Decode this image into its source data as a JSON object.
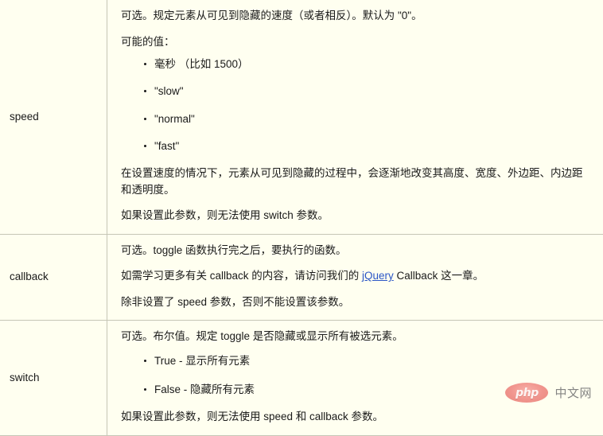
{
  "page": {
    "background_color": "#fffff0",
    "border_color": "#c6c6b6",
    "text_color": "#1a1a1a",
    "link_color": "#2b56c6"
  },
  "table": {
    "rows": [
      {
        "name": "speed",
        "blocks": [
          {
            "type": "paragraph",
            "text": "可选。规定元素从可见到隐藏的速度（或者相反）。默认为 \"0\"。"
          },
          {
            "type": "paragraph",
            "text": "可能的值："
          },
          {
            "type": "list",
            "items": [
              "毫秒 （比如 1500）",
              "\"slow\"",
              "\"normal\"",
              "\"fast\""
            ]
          },
          {
            "type": "paragraph",
            "text": "在设置速度的情况下，元素从可见到隐藏的过程中，会逐渐地改变其高度、宽度、外边距、内边距和透明度。"
          },
          {
            "type": "paragraph",
            "text": "如果设置此参数，则无法使用 switch 参数。"
          }
        ]
      },
      {
        "name": "callback",
        "blocks": [
          {
            "type": "paragraph",
            "text": "可选。toggle 函数执行完之后，要执行的函数。"
          },
          {
            "type": "paragraph_with_link",
            "before": "如需学习更多有关 callback 的内容，请访问我们的 ",
            "link_text": "jQuery",
            "after": " Callback 这一章。"
          },
          {
            "type": "paragraph",
            "text": "除非设置了 speed 参数，否则不能设置该参数。"
          }
        ]
      },
      {
        "name": "switch",
        "blocks": [
          {
            "type": "paragraph",
            "text": "可选。布尔值。规定 toggle 是否隐藏或显示所有被选元素。"
          },
          {
            "type": "list",
            "items": [
              "True - 显示所有元素",
              "False - 隐藏所有元素"
            ]
          },
          {
            "type": "paragraph",
            "text": "如果设置此参数，则无法使用 speed 和 callback 参数。"
          }
        ]
      }
    ]
  },
  "watermark": {
    "badge_text": "php",
    "site_text": "中文网",
    "badge_color": "#ef8b84"
  }
}
